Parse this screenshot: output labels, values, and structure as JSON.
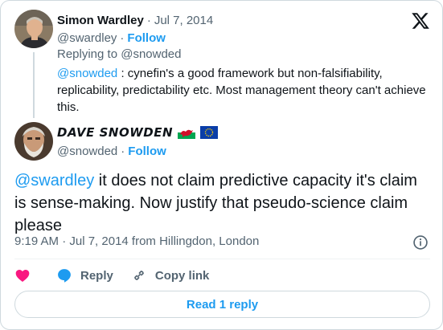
{
  "parent_tweet": {
    "display_name": "Simon Wardley",
    "separator": "·",
    "date": "Jul 7, 2014",
    "handle": "@swardley",
    "handle_separator": "·",
    "follow_label": "Follow",
    "replying_to": "Replying to @snowded",
    "mention": "@snowded",
    "text": " : cynefin's a good framework but non-falsifiability, replicability, predictability etc. Most management theory can't achieve this."
  },
  "main_tweet": {
    "display_name": "DAVE SNOWDEN",
    "flags": [
      "wales-flag-icon",
      "eu-flag-icon"
    ],
    "handle": "@snowded",
    "handle_separator": "·",
    "follow_label": "Follow",
    "mention": "@swardley",
    "text": " it does not claim predictive capacity it's claim is sense-making.   Now justify that pseudo-science claim please",
    "timestamp": "9:19 AM · Jul 7, 2014 from Hillingdon, London"
  },
  "actions": {
    "reply_label": "Reply",
    "copy_link_label": "Copy link"
  },
  "read_replies_label": "Read 1 reply",
  "colors": {
    "accent": "#1d9bf0",
    "like": "#f91880",
    "text_secondary": "#536471",
    "border": "#cfd9de"
  },
  "icons": [
    "x-logo-icon",
    "info-icon",
    "heart-icon",
    "reply-bubble-icon",
    "link-icon"
  ]
}
